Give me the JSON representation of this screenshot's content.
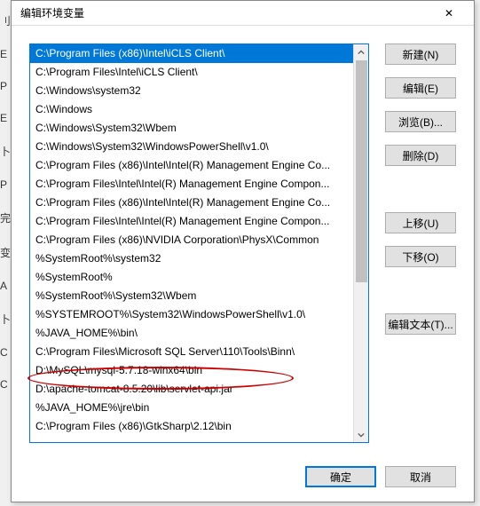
{
  "dialog": {
    "title": "编辑环境变量",
    "close_label": "✕"
  },
  "list": {
    "items": [
      "C:\\Program Files (x86)\\Intel\\iCLS Client\\",
      "C:\\Program Files\\Intel\\iCLS Client\\",
      "C:\\Windows\\system32",
      "C:\\Windows",
      "C:\\Windows\\System32\\Wbem",
      "C:\\Windows\\System32\\WindowsPowerShell\\v1.0\\",
      "C:\\Program Files (x86)\\Intel\\Intel(R) Management Engine Co...",
      "C:\\Program Files\\Intel\\Intel(R) Management Engine Compon...",
      "C:\\Program Files (x86)\\Intel\\Intel(R) Management Engine Co...",
      "C:\\Program Files\\Intel\\Intel(R) Management Engine Compon...",
      "C:\\Program Files (x86)\\NVIDIA Corporation\\PhysX\\Common",
      "%SystemRoot%\\system32",
      "%SystemRoot%",
      "%SystemRoot%\\System32\\Wbem",
      "%SYSTEMROOT%\\System32\\WindowsPowerShell\\v1.0\\",
      "%JAVA_HOME%\\bin\\",
      "C:\\Program Files\\Microsoft SQL Server\\110\\Tools\\Binn\\",
      "D:\\MySQL\\mysql-5.7.18-winx64\\bin",
      "D:\\apache-tomcat-8.5.20\\lib\\servlet-api.jar",
      "%JAVA_HOME%\\jre\\bin",
      "C:\\Program Files (x86)\\GtkSharp\\2.12\\bin"
    ],
    "selected_index": 0
  },
  "buttons": {
    "new": "新建(N)",
    "edit": "编辑(E)",
    "browse": "浏览(B)...",
    "delete": "删除(D)",
    "moveup": "上移(U)",
    "movedown": "下移(O)",
    "edittext": "编辑文本(T)...",
    "ok": "确定",
    "cancel": "取消"
  },
  "bg_chars": [
    "刂",
    "E",
    "P",
    "E",
    "卜",
    "P",
    " ",
    "完",
    "变",
    "A",
    "卜",
    "C",
    "C"
  ]
}
